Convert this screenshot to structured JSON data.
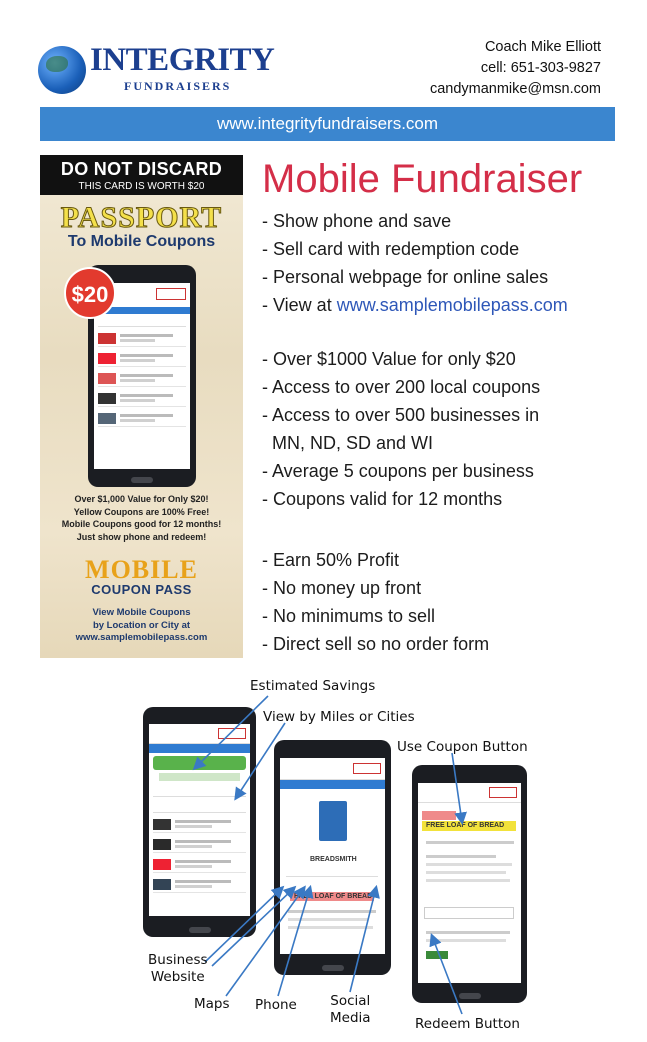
{
  "header": {
    "brand_name": "INTEGRITY",
    "brand_sub": "FUNDRAISERS",
    "contact_name": "Coach Mike Elliott",
    "contact_phone": "cell: 651-303-9827",
    "contact_email": "candymanmike@msn.com",
    "website": "www.integrityfundraisers.com"
  },
  "card": {
    "top_line1": "DO NOT DISCARD",
    "top_line2": "THIS CARD IS WORTH $20",
    "passport": "PASSPORT",
    "to_mobile": "To Mobile Coupons",
    "badge": "$20",
    "blurb": [
      "Over $1,000 Value for Only $20!",
      "Yellow Coupons are 100% Free!",
      "Mobile Coupons good for 12 months!",
      "Just show phone and redeem!"
    ],
    "logo_line1": "MOBILE",
    "logo_line2": "COUPON PASS",
    "view_lines": [
      "View Mobile Coupons",
      "by Location or City at",
      "www.samplemobilepass.com"
    ]
  },
  "headline": "Mobile Fundraiser",
  "features_1": [
    "- Show phone and save",
    "- Sell card with redemption code",
    "- Personal webpage for online sales"
  ],
  "view_at_prefix": "- View at ",
  "view_at_link": "www.samplemobilepass.com",
  "features_2": [
    "- Over $1000 Value for only $20",
    "- Access to over 200 local coupons",
    "- Access to over 500 businesses in",
    "  MN, ND, SD and WI",
    "- Average 5 coupons per business",
    "- Coupons valid for 12 months"
  ],
  "features_3": [
    "- Earn 50% Profit",
    "- No money up front",
    "- No minimums to sell",
    "- Direct sell so no order form"
  ],
  "callouts": {
    "estimated_savings": "Estimated Savings",
    "view_by_miles": "View by Miles or Cities",
    "use_coupon_button": "Use Coupon Button",
    "business_website_1": "Business",
    "business_website_2": "Website",
    "maps": "Maps",
    "phone": "Phone",
    "social_1": "Social",
    "social_2": "Media",
    "redeem_button": "Redeem Button"
  },
  "phone_screens": {
    "free_bread_1": "FREE LOAF OF BREAD",
    "free_bread_2": "FREE LOAF OF BREAD",
    "breadsmith": "BREADSMITH"
  },
  "colors": {
    "url_bar": "#3b86cf",
    "headline": "#d42e48",
    "link": "#2e57b8",
    "brand": "#1c3f8f"
  }
}
